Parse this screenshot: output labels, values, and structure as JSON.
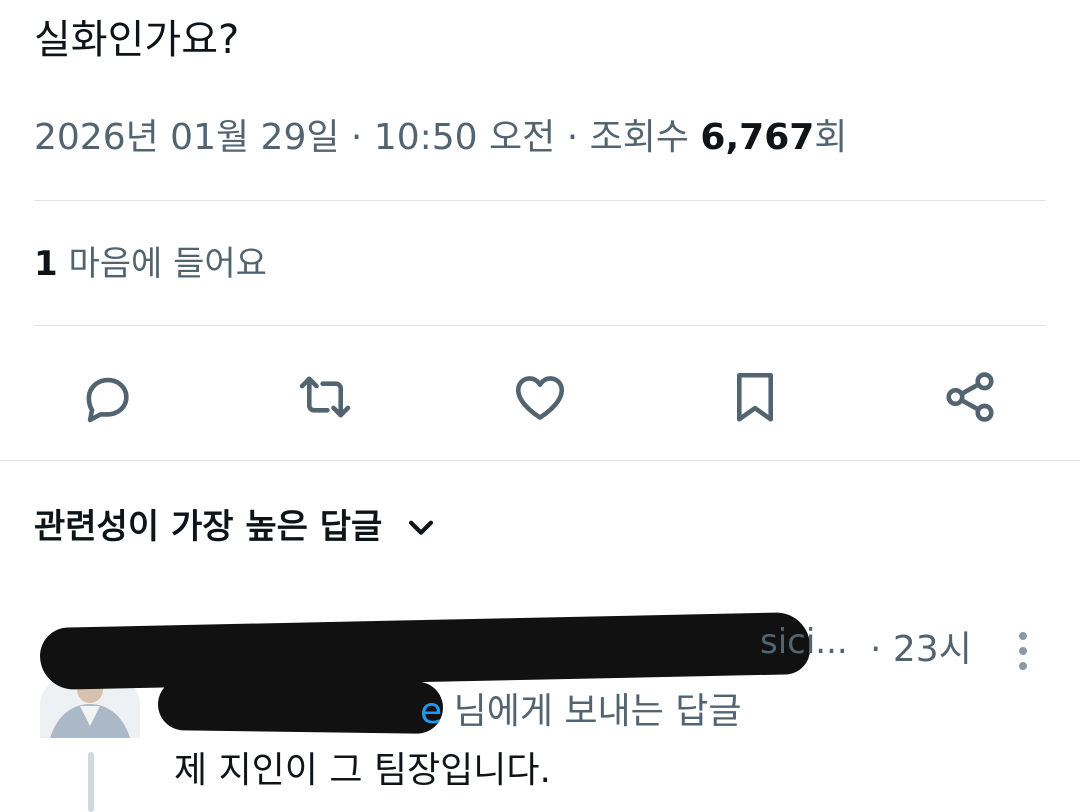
{
  "post": {
    "text": "실화인가요?",
    "date": "2026년 01월 29일",
    "sep1": " · ",
    "time": "10:50 오전",
    "sep2": " · ",
    "views_label": "조회수 ",
    "views_count": "6,767",
    "views_suffix": "회"
  },
  "likes": {
    "count": "1",
    "label": " 마음에 들어요"
  },
  "actions": [
    {
      "name": "reply",
      "icon": "reply-icon"
    },
    {
      "name": "repost",
      "icon": "repost-icon"
    },
    {
      "name": "like",
      "icon": "heart-icon"
    },
    {
      "name": "bookmark",
      "icon": "bookmark-icon"
    },
    {
      "name": "share",
      "icon": "share-icon"
    }
  ],
  "replies_sort": {
    "label": "관련성이 가장 높은 답글",
    "icon": "chevron-down-icon"
  },
  "reply": {
    "handle_truncated": "sici...",
    "time": "· 23시",
    "replying_prefix": "e",
    "replying_to": " 님에게 보내는 답글",
    "body": "제 지인이 그 팀장입니다."
  },
  "colors": {
    "text": "#0f1419",
    "secondary": "#536471",
    "divider": "#dfe3e6",
    "link": "#1d9bf0"
  }
}
